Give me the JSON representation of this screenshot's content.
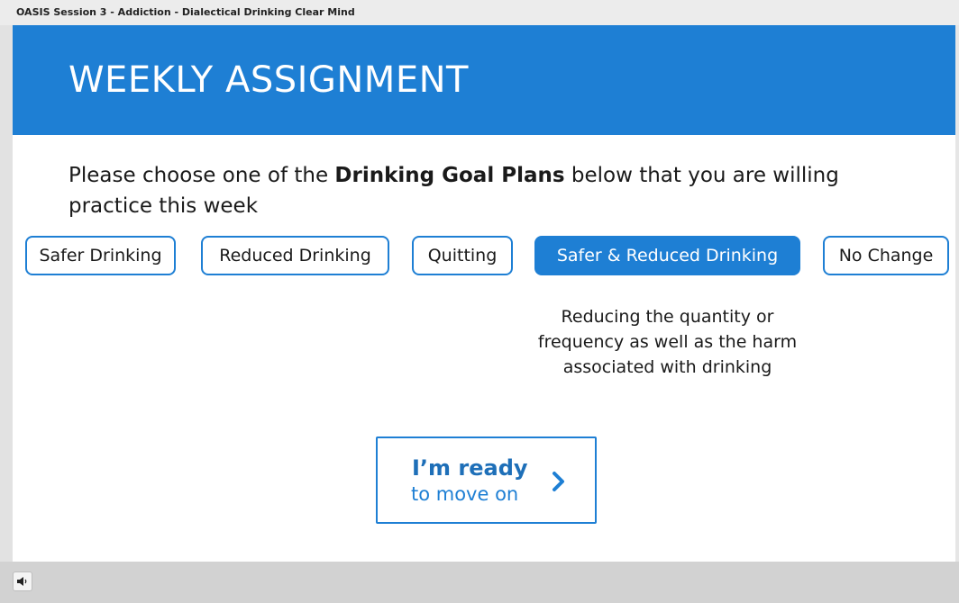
{
  "window": {
    "title": "OASIS Session 3 - Addiction - Dialectical Drinking Clear Mind"
  },
  "banner": {
    "title": "WEEKLY ASSIGNMENT"
  },
  "prompt": {
    "before": "Please choose one of the ",
    "bold": "Drinking Goal Plans",
    "after": " below that you are willing practice this week"
  },
  "options": [
    {
      "label": "Safer Drinking",
      "selected": false
    },
    {
      "label": "Reduced Drinking",
      "selected": false
    },
    {
      "label": "Quitting",
      "selected": false
    },
    {
      "label": "Safer & Reduced Drinking",
      "selected": true
    },
    {
      "label": "No Change",
      "selected": false
    }
  ],
  "selected_description": "Reducing the quantity or frequency as well as the harm associated with drinking",
  "next_button": {
    "line1": "I’m ready",
    "line2": "to move on",
    "icon": "chevron-right-icon"
  },
  "player": {
    "audio_icon": "speaker-icon"
  },
  "colors": {
    "accent": "#1e7fd4",
    "banner_text": "#ffffff",
    "body_text": "#1a1a1a",
    "chrome": "#d2d2d2"
  }
}
